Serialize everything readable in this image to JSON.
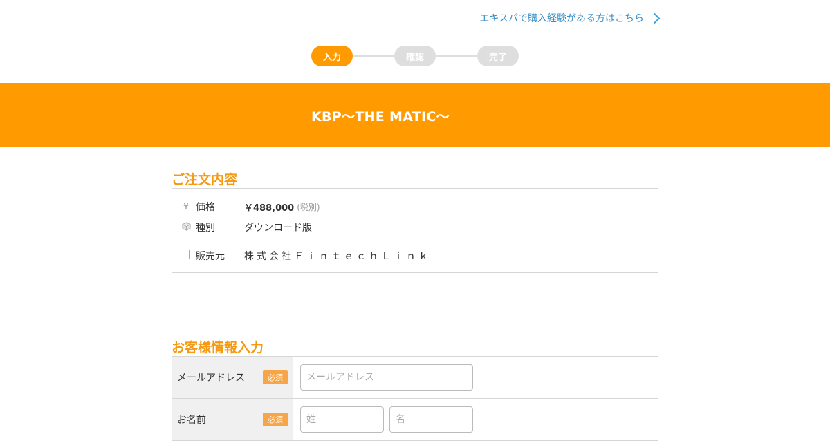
{
  "header": {
    "returning_link": "エキスパで購入経験がある方はこちら"
  },
  "steps": [
    {
      "label": "入力",
      "state": "active"
    },
    {
      "label": "確認",
      "state": "inactive"
    },
    {
      "label": "完了",
      "state": "inactive"
    }
  ],
  "banner": {
    "title": "KBP〜THE MATIC〜"
  },
  "order": {
    "section_title": "ご注文内容",
    "price_label": "価格",
    "price_value": "￥488,000",
    "price_note": "(税別)",
    "type_label": "種別",
    "type_value": "ダウンロード版",
    "vendor_label": "販売元",
    "vendor_value": "株式会社ＦｉｎｔｅｃｈＬｉｎｋ",
    "icons": {
      "price": "yen-icon",
      "type": "box-icon",
      "vendor": "building-icon"
    }
  },
  "customer": {
    "section_title": "お客様情報入力",
    "required_badge": "必須",
    "email_label": "メールアドレス",
    "email_placeholder": "メールアドレス",
    "email_value": "",
    "name_label": "お名前",
    "last_name_placeholder": "姓",
    "first_name_placeholder": "名"
  },
  "colors": {
    "accent": "#ff9b00",
    "link": "#3a8fc6",
    "step_inactive": "#dedede"
  }
}
